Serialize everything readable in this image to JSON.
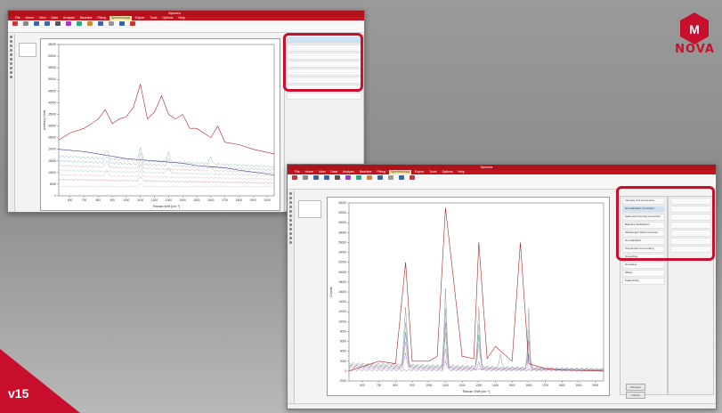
{
  "brand": {
    "name": "NOVA",
    "version": "v15",
    "accent": "#c8102e"
  },
  "window1": {
    "title": "Spectra",
    "tabs": [
      "File",
      "Home",
      "View",
      "Data",
      "Analysis",
      "Baseline",
      "Fitting",
      "Spectroscopy",
      "Export",
      "Tools",
      "Options",
      "Help"
    ],
    "active_tab": "Spectroscopy",
    "chart": {
      "xlabel": "Raman shift [cm⁻¹]",
      "ylabel": "Arbitrary Units",
      "xticks": [
        "600",
        "700",
        "800",
        "900",
        "1000",
        "1100",
        "1200",
        "1300",
        "1400",
        "1500",
        "1600",
        "1700",
        "1800",
        "1900",
        "2000"
      ],
      "yticks": [
        "0",
        "5000",
        "10000",
        "15000",
        "20000",
        "25000",
        "30000",
        "35000",
        "40000",
        "45000",
        "50000",
        "55000",
        "60000",
        "65000"
      ]
    }
  },
  "window2": {
    "title": "Spectra",
    "tabs": [
      "File",
      "Home",
      "View",
      "Data",
      "Analysis",
      "Baseline",
      "Fitting",
      "Spectroscopy",
      "Export",
      "Tools",
      "Options",
      "Help"
    ],
    "active_tab": "Spectroscopy",
    "chart": {
      "xlabel": "Raman Shift [cm⁻¹]",
      "ylabel": "Counts",
      "xticks": [
        "600",
        "700",
        "800",
        "900",
        "1000",
        "1100",
        "1200",
        "1300",
        "1400",
        "1500",
        "1600",
        "1700",
        "1800",
        "1900",
        "2000"
      ],
      "yticks": [
        "-2000",
        "0",
        "2000",
        "4000",
        "6000",
        "8000",
        "10000",
        "12000",
        "14000",
        "16000",
        "18000",
        "20000",
        "22000",
        "24000",
        "26000",
        "28000",
        "30000",
        "32000",
        "34000"
      ]
    },
    "steps": [
      "Intensity Unit Conversion",
      "Normalization Correction",
      "Spike and Intensity Correction",
      "Baseline Subtraction",
      "Wavelength Shift Correction",
      "Normalization",
      "Polynomial Curve Fitting",
      "Smoothing",
      "Derivative",
      "Offset",
      "Peak Fitting"
    ],
    "buttons": {
      "ok": "Remove",
      "apply": "Cancel"
    }
  },
  "chart_data": [
    {
      "type": "line",
      "xlabel": "Raman shift [cm⁻¹]",
      "ylabel": "Arbitrary Units",
      "ylim": [
        0,
        65000
      ],
      "xlim": [
        520,
        2050
      ],
      "series": [
        {
          "values_x": [
            520,
            600,
            700,
            800,
            850,
            900,
            950,
            1000,
            1050,
            1100,
            1150,
            1200,
            1250,
            1300,
            1350,
            1400,
            1450,
            1500,
            1550,
            1600,
            1650,
            1700,
            1800,
            1900,
            2050
          ],
          "values": [
            24000,
            27000,
            29000,
            33000,
            37000,
            31000,
            33000,
            34000,
            38000,
            48000,
            33000,
            36000,
            43000,
            35000,
            33000,
            35000,
            29000,
            29000,
            27000,
            25000,
            30000,
            23000,
            22000,
            20000,
            18000
          ]
        },
        {
          "values_x": [
            520,
            700,
            800,
            900,
            1000,
            1100,
            1200,
            1300,
            1400,
            1500,
            1600,
            1700,
            1800,
            2050
          ],
          "values": [
            20000,
            19000,
            18000,
            17000,
            16000,
            15500,
            15000,
            14500,
            14000,
            13000,
            12500,
            12000,
            11000,
            9000
          ]
        }
      ]
    },
    {
      "type": "line",
      "xlabel": "Raman Shift [cm⁻¹]",
      "ylabel": "Counts",
      "ylim": [
        -2000,
        34000
      ],
      "xlim": [
        520,
        2050
      ],
      "series": [
        {
          "values_x": [
            520,
            700,
            800,
            860,
            900,
            1000,
            1050,
            1100,
            1200,
            1270,
            1300,
            1350,
            1400,
            1500,
            1550,
            1600,
            1700,
            1800,
            2050
          ],
          "values": [
            0,
            2000,
            1500,
            22000,
            2000,
            2000,
            3000,
            33000,
            3000,
            2500,
            26000,
            2500,
            5000,
            2000,
            26000,
            1500,
            500,
            200,
            0
          ]
        }
      ]
    }
  ]
}
